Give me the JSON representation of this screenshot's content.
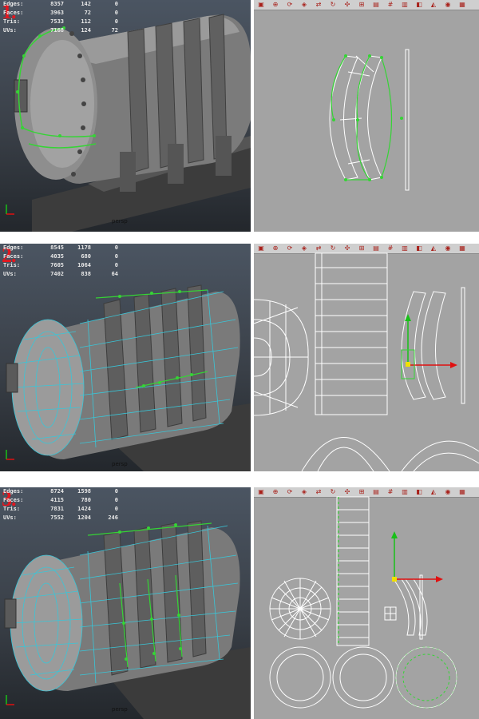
{
  "panels": [
    {
      "step": "1.",
      "stats": [
        {
          "label": "Edges:",
          "v1": "8357",
          "v2": "142",
          "v3": "0"
        },
        {
          "label": "Faces:",
          "v1": "3963",
          "v2": "72",
          "v3": "0"
        },
        {
          "label": "Tris:",
          "v1": "7533",
          "v2": "112",
          "v3": "0"
        },
        {
          "label": "UVs:",
          "v1": "7168",
          "v2": "124",
          "v3": "72"
        }
      ],
      "camera": "persp"
    },
    {
      "step": "2.",
      "stats": [
        {
          "label": "Edges:",
          "v1": "8545",
          "v2": "1178",
          "v3": "0"
        },
        {
          "label": "Faces:",
          "v1": "4035",
          "v2": "680",
          "v3": "0"
        },
        {
          "label": "Tris:",
          "v1": "7605",
          "v2": "1064",
          "v3": "0"
        },
        {
          "label": "UVs:",
          "v1": "7402",
          "v2": "838",
          "v3": "64"
        }
      ],
      "camera": "persp"
    },
    {
      "step": "3.",
      "stats": [
        {
          "label": "Edges:",
          "v1": "8724",
          "v2": "1598",
          "v3": "0"
        },
        {
          "label": "Faces:",
          "v1": "4115",
          "v2": "780",
          "v3": "0"
        },
        {
          "label": "Tris:",
          "v1": "7831",
          "v2": "1424",
          "v3": "0"
        },
        {
          "label": "UVs:",
          "v1": "7552",
          "v2": "1204",
          "v3": "246"
        }
      ],
      "camera": "persp"
    }
  ],
  "axis": {
    "y": "y",
    "x": "x"
  },
  "toolbar_icons": [
    "select-icon",
    "move-icon",
    "rotate-icon",
    "scale-icon",
    "flip-icon",
    "rotate-uv-icon",
    "unfold-icon",
    "layout-icon",
    "snapshot-icon",
    "grid-icon",
    "image-icon",
    "texture-icon",
    "filter-icon",
    "display-icon",
    "options-icon"
  ],
  "colors": {
    "wire": "#39c6d8",
    "selected": "#35d435",
    "axis_y": "#18c018",
    "axis_x": "#e01010",
    "step": "#e3171f"
  }
}
